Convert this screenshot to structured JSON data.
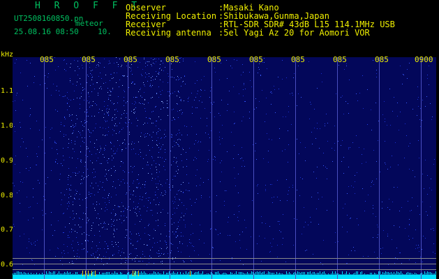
{
  "header": {
    "brand": "H R O F F T",
    "file_name": "UT2508160850.pn",
    "file_suffix": "meteor",
    "datetime": "25.08.16 08:50",
    "interval": "10."
  },
  "metadata": [
    {
      "label": "Observer",
      "value": ":Masaki Kano"
    },
    {
      "label": "Receiving Location",
      "value": ":Shibukawa,Gunma,Japan"
    },
    {
      "label": "Receiver",
      "value": ":RTL-SDR SDR# 43dB L15 114.1MHz USB"
    },
    {
      "label": "Receiving antenna",
      "value": ":5el Yagi Az 20 for Aomori VOR"
    }
  ],
  "axes": {
    "y_unit": "kHz",
    "y_ticks": [
      "1.1",
      "1.0",
      "0.9",
      "0.8",
      "0.7",
      "0.6"
    ],
    "x_ticks": [
      "085",
      "085",
      "085",
      "085",
      "085",
      "085",
      "085",
      "085",
      "085",
      "0900"
    ]
  },
  "colors": {
    "background": "#000000",
    "plot_bg": "#03075a",
    "label_yellow": "#f0f000",
    "header_green": "#00c060",
    "noise_floor": "#00e0ff"
  }
}
